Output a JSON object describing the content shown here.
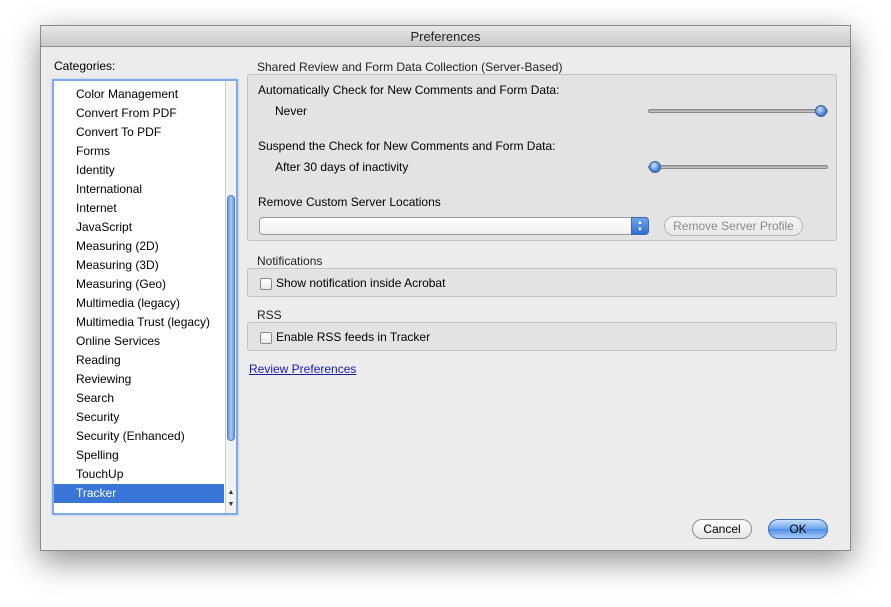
{
  "window": {
    "title": "Preferences"
  },
  "categories": {
    "label": "Categories:",
    "items": [
      "Color Management",
      "Convert From PDF",
      "Convert To PDF",
      "Forms",
      "Identity",
      "International",
      "Internet",
      "JavaScript",
      "Measuring (2D)",
      "Measuring (3D)",
      "Measuring (Geo)",
      "Multimedia (legacy)",
      "Multimedia Trust (legacy)",
      "Online Services",
      "Reading",
      "Reviewing",
      "Search",
      "Security",
      "Security (Enhanced)",
      "Spelling",
      "TouchUp",
      "Tracker"
    ],
    "selected": "Tracker"
  },
  "shared_review": {
    "title": "Shared Review and Form Data Collection (Server-Based)",
    "auto_check_label": "Automatically Check for New Comments and Form Data:",
    "auto_check_value": "Never",
    "suspend_label": "Suspend the Check for New Comments and Form Data:",
    "suspend_value": "After 30 days of inactivity",
    "remove_label": "Remove Custom Server Locations",
    "server_select_value": "",
    "remove_button": "Remove Server Profile"
  },
  "notifications": {
    "title": "Notifications",
    "checkbox_label": "Show notification inside Acrobat",
    "checked": false
  },
  "rss": {
    "title": "RSS",
    "checkbox_label": "Enable RSS feeds in Tracker",
    "checked": false
  },
  "review_link": "Review Preferences",
  "buttons": {
    "cancel": "Cancel",
    "ok": "OK"
  },
  "colors": {
    "selection": "#3875d7",
    "accent": "#4d8de6",
    "link": "#1a1aa6"
  }
}
